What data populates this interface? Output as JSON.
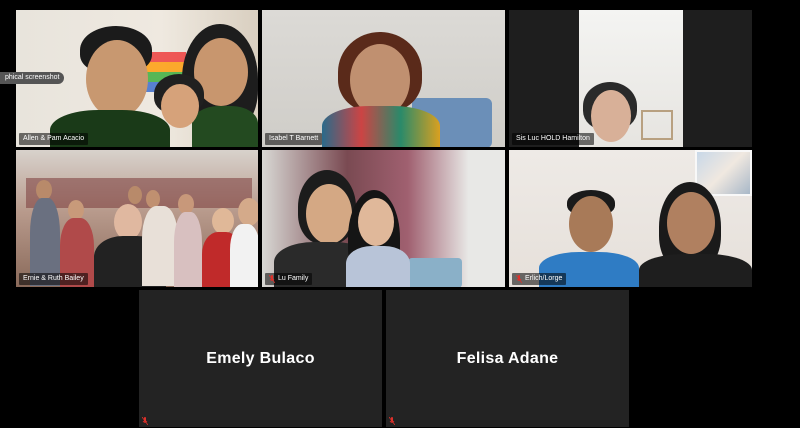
{
  "participants": [
    {
      "name": "Allen & Pam Acacio",
      "muted": false
    },
    {
      "name": "Isabel T Barnett",
      "muted": false
    },
    {
      "name": "Sis Luc   HOLD Hamilton",
      "muted": false
    },
    {
      "name": "Ernie & Ruth Bailey",
      "muted": false,
      "active_speaker": true
    },
    {
      "name": "Lu Family",
      "muted": true
    },
    {
      "name": "Erlich/Lorge",
      "muted": true
    },
    {
      "name": "Emely Bulaco",
      "muted": true,
      "video": false
    },
    {
      "name": "Felisa Adane",
      "muted": true,
      "video": false
    }
  ],
  "tooltip": {
    "text": "phical screenshot"
  },
  "colors": {
    "background": "#000000",
    "tile": "#232323",
    "active_outline": "#d8e25a",
    "muted_icon": "#e0302a"
  },
  "icons": {
    "muted": "mic-off-icon"
  }
}
